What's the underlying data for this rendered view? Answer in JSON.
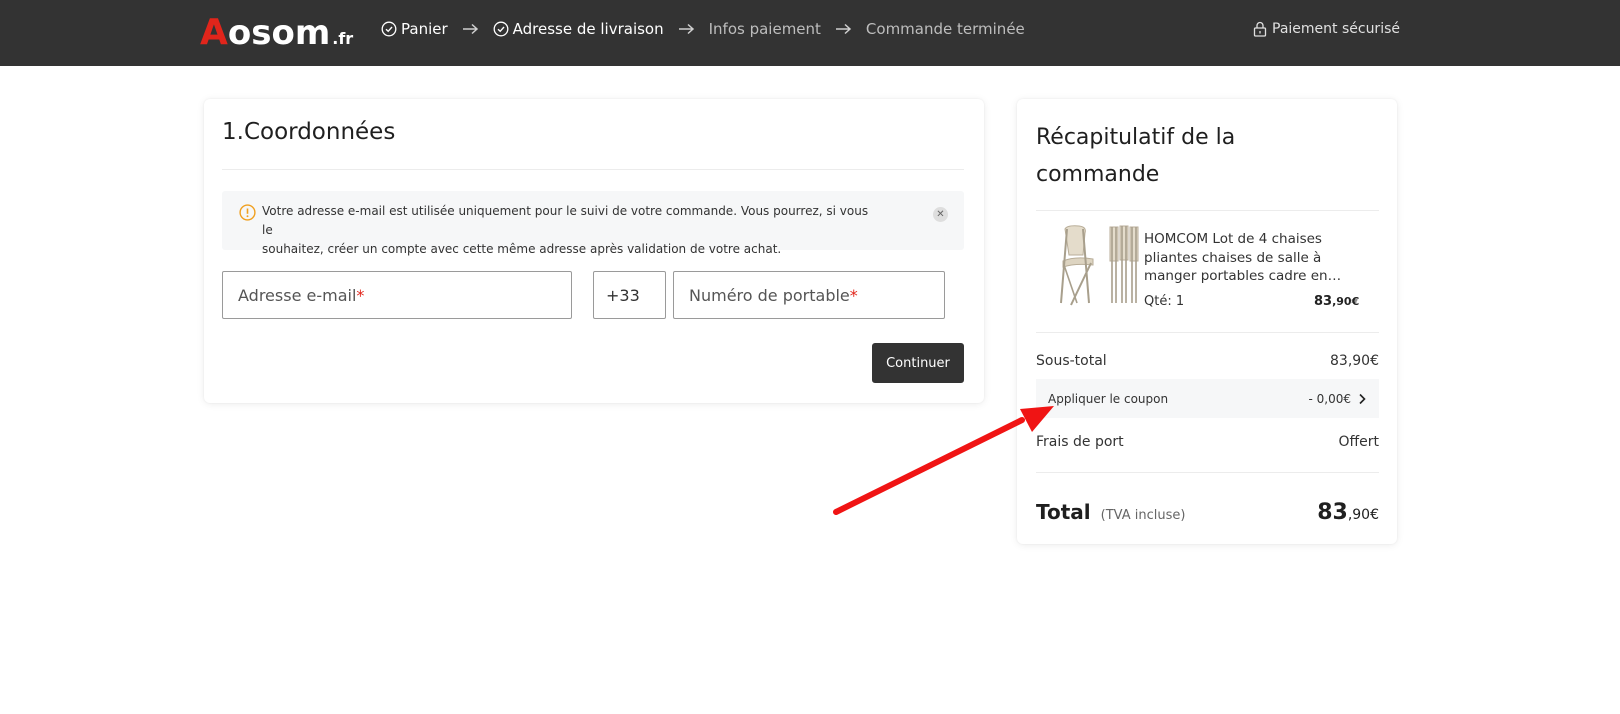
{
  "brand": {
    "logo_first": "A",
    "logo_rest": "osom",
    "logo_tld": ".fr",
    "accent_color": "#e1251b",
    "header_bg": "#333333"
  },
  "steps": [
    {
      "label": "Panier",
      "done": true,
      "icon": "check-circle-icon"
    },
    {
      "label": "Adresse de livraison",
      "done": true,
      "icon": "check-circle-icon"
    },
    {
      "label": "Infos paiement",
      "done": false
    },
    {
      "label": "Commande terminée",
      "done": false
    }
  ],
  "secure": {
    "label": "Paiement sécurisé",
    "icon": "lock-icon"
  },
  "contact": {
    "title": "1.Coordonnées",
    "notice_line1": "Votre adresse e-mail est utilisée uniquement pour le suivi de votre commande. Vous pourrez, si vous le",
    "notice_line2": "souhaitez, créer un compte avec cette même adresse après validation de votre achat.",
    "email_placeholder": "Adresse e-mail",
    "country_code": "+33",
    "phone_placeholder": "Numéro de portable",
    "required_mark": "*",
    "continue_label": "Continuer"
  },
  "summary": {
    "title": "Récapitulatif de la commande",
    "product": {
      "name": "HOMCOM Lot de 4 chaises pliantes chaises de salle à manger portables cadre en…",
      "qty": "Qté: 1",
      "price_int": "83",
      "price_dec": ",90€"
    },
    "subtotal_label": "Sous-total",
    "subtotal_value": "83,90€",
    "coupon_label": "Appliquer le coupon",
    "coupon_value": "- 0,00€",
    "shipping_label": "Frais de port",
    "shipping_value": "Offert",
    "total_label": "Total",
    "total_note": "(TVA incluse)",
    "total_int": "83",
    "total_dec": ",90€"
  }
}
